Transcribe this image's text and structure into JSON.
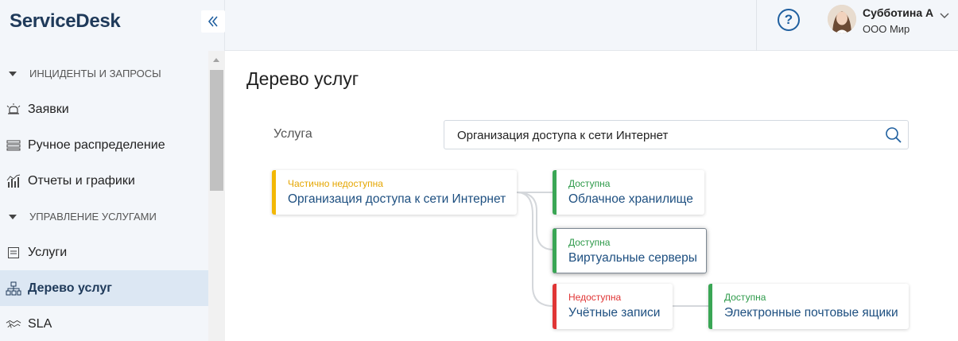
{
  "app": {
    "logo": "ServiceDesk"
  },
  "sidebar": {
    "groups": [
      {
        "label": "ИНЦИДЕНТЫ И ЗАПРОСЫ",
        "items": [
          {
            "label": "Заявки",
            "icon": "bell-icon"
          },
          {
            "label": "Ручное распределение",
            "icon": "list-icon"
          },
          {
            "label": "Отчеты и графики",
            "icon": "chart-icon"
          }
        ]
      },
      {
        "label": "УПРАВЛЕНИЕ УСЛУГАМИ",
        "items": [
          {
            "label": "Услуги",
            "icon": "document-icon"
          },
          {
            "label": "Дерево услуг",
            "icon": "tree-icon",
            "active": true
          },
          {
            "label": "SLA",
            "icon": "handshake-icon"
          }
        ]
      }
    ]
  },
  "header": {
    "help_label": "?",
    "user": {
      "name": "Субботина А",
      "org": "ООО Мир"
    }
  },
  "main": {
    "title": "Дерево услуг",
    "service_field": {
      "label": "Услуга",
      "value": "Организация доступа к сети Интернет"
    },
    "tree": {
      "root": {
        "status": "Частично недоступна",
        "name": "Организация доступа к сети Интернет",
        "status_color": "#f2b705"
      },
      "children": [
        {
          "status": "Доступна",
          "name": "Облачное хранилище",
          "status_color": "#3aa655"
        },
        {
          "status": "Доступна",
          "name": "Виртуальные серверы",
          "status_color": "#3aa655"
        },
        {
          "status": "Недоступна",
          "name": "Учётные записи",
          "status_color": "#e03535"
        }
      ],
      "grandchild": {
        "status": "Доступна",
        "name": "Электронные почтовые ящики",
        "status_color": "#3aa655"
      }
    }
  }
}
